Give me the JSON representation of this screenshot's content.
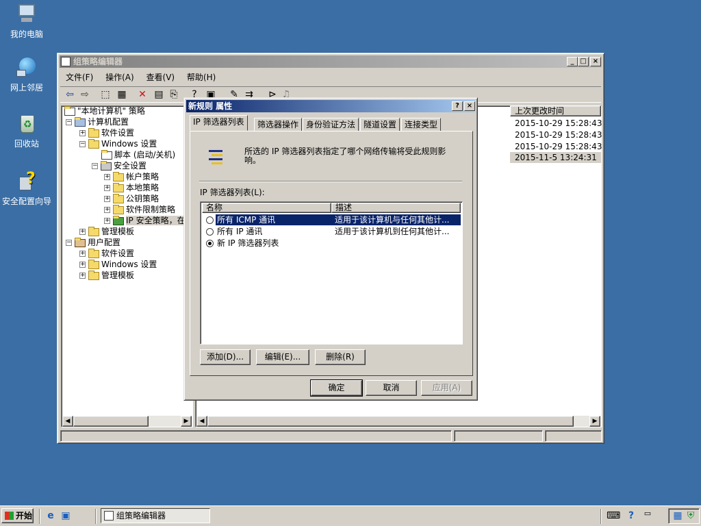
{
  "desktop": {
    "icons": [
      {
        "label": "我的电脑",
        "icon": "my-computer-icon"
      },
      {
        "label": "网上邻居",
        "icon": "network-places-icon"
      },
      {
        "label": "回收站",
        "icon": "recycle-bin-icon"
      },
      {
        "label": "安全配置向导",
        "icon": "security-wizard-icon"
      }
    ]
  },
  "mmc": {
    "title": "组策略编辑器",
    "menu": [
      "文件(F)",
      "操作(A)",
      "查看(V)",
      "帮助(H)"
    ],
    "tree": [
      {
        "label": "\"本地计算机\" 策略"
      },
      {
        "label": "计算机配置"
      },
      {
        "label": "软件设置"
      },
      {
        "label": "Windows 设置"
      },
      {
        "label": "脚本 (启动/关机)"
      },
      {
        "label": "安全设置"
      },
      {
        "label": "帐户策略"
      },
      {
        "label": "本地策略"
      },
      {
        "label": "公钥策略"
      },
      {
        "label": "软件限制策略"
      },
      {
        "label": "IP 安全策略，在"
      },
      {
        "label": "管理模板"
      },
      {
        "label": "用户配置"
      },
      {
        "label": "软件设置"
      },
      {
        "label": "Windows 设置"
      },
      {
        "label": "管理模板"
      }
    ],
    "list_header": "上次更改时间",
    "list_rows": [
      "2015-10-29 15:28:43",
      "2015-10-29 15:28:43",
      "2015-10-29 15:28:43",
      "2015-11-5 13:24:31"
    ]
  },
  "dialog": {
    "title": "新规则 属性",
    "help_btn": "?",
    "close_btn": "×",
    "tabs": [
      "IP 筛选器列表",
      "筛选器操作",
      "身份验证方法",
      "隧道设置",
      "连接类型"
    ],
    "info_text": "所选的 IP 筛选器列表指定了哪个网络传输将受此规则影响。",
    "list_label": "IP 筛选器列表(L):",
    "columns": [
      "名称",
      "描述"
    ],
    "rows": [
      {
        "name": "所有 ICMP 通讯",
        "desc": "适用于该计算机与任何其他计...",
        "selected": true,
        "checked": false
      },
      {
        "name": "所有 IP 通讯",
        "desc": "适用于该计算机到任何其他计...",
        "selected": false,
        "checked": false
      },
      {
        "name": "新 IP 筛选器列表",
        "desc": "",
        "selected": false,
        "checked": true
      }
    ],
    "buttons": {
      "add": "添加(D)...",
      "edit": "编辑(E)...",
      "delete": "删除(R)"
    },
    "footer": {
      "ok": "确定",
      "cancel": "取消",
      "apply": "应用(A)"
    }
  },
  "taskbar": {
    "start": "开始",
    "task": "组策略编辑器"
  },
  "colors": {
    "desktop": "#3a6ea5",
    "title_active": "#0a246a",
    "selection": "#0a246a"
  }
}
